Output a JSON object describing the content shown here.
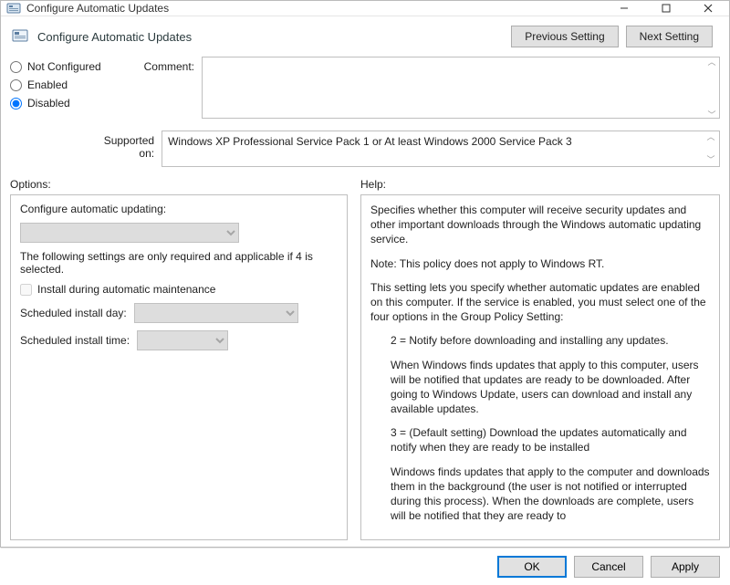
{
  "window": {
    "title": "Configure Automatic Updates"
  },
  "header": {
    "title": "Configure Automatic Updates",
    "prev_button": "Previous Setting",
    "next_button": "Next Setting"
  },
  "state": {
    "not_configured_label": "Not Configured",
    "enabled_label": "Enabled",
    "disabled_label": "Disabled"
  },
  "comment": {
    "label": "Comment:",
    "value": ""
  },
  "supported": {
    "label": "Supported on:",
    "value": "Windows XP Professional Service Pack 1 or At least Windows 2000 Service Pack 3"
  },
  "sections": {
    "options_label": "Options:",
    "help_label": "Help:"
  },
  "options": {
    "configure_label": "Configure automatic updating:",
    "note": "The following settings are only required and applicable if 4 is selected.",
    "install_maint_label": "Install during automatic maintenance",
    "sched_day_label": "Scheduled install day:",
    "sched_time_label": "Scheduled install time:"
  },
  "help": {
    "p1": "Specifies whether this computer will receive security updates and other important downloads through the Windows automatic updating service.",
    "p2": "Note: This policy does not apply to Windows RT.",
    "p3": "This setting lets you specify whether automatic updates are enabled on this computer. If the service is enabled, you must select one of the four options in the Group Policy Setting:",
    "p4": "2 = Notify before downloading and installing any updates.",
    "p5": "When Windows finds updates that apply to this computer, users will be notified that updates are ready to be downloaded. After going to Windows Update, users can download and install any available updates.",
    "p6": "3 = (Default setting) Download the updates automatically and notify when they are ready to be installed",
    "p7": "Windows finds updates that apply to the computer and downloads them in the background (the user is not notified or interrupted during this process). When the downloads are complete, users will be notified that they are ready to"
  },
  "footer": {
    "ok": "OK",
    "cancel": "Cancel",
    "apply": "Apply"
  }
}
